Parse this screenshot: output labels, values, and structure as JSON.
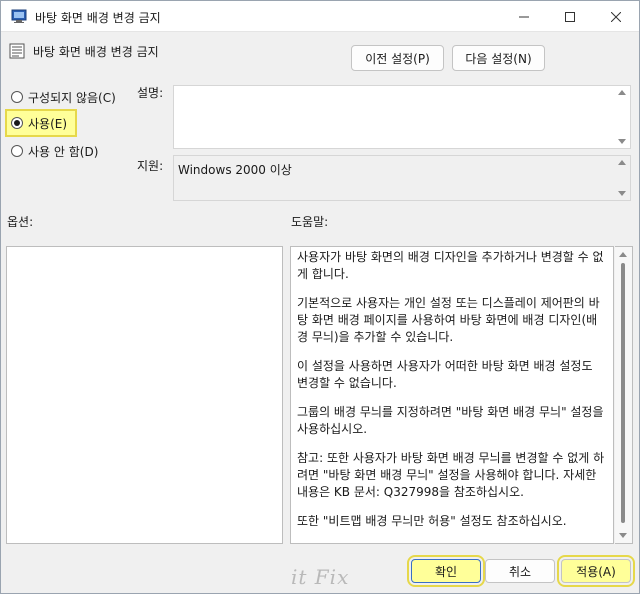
{
  "window": {
    "title": "바탕 화면 배경 변경 금지",
    "controls": {
      "minimize": "minimize-icon",
      "maximize": "maximize-icon",
      "close": "close-icon"
    }
  },
  "header": {
    "policy_title": "바탕 화면 배경 변경 금지",
    "prev_button": "이전 설정(P)",
    "next_button": "다음 설정(N)"
  },
  "radios": [
    {
      "label": "구성되지 않음(C)",
      "checked": false
    },
    {
      "label": "사용(E)",
      "checked": true
    },
    {
      "label": "사용 안 함(D)",
      "checked": false
    }
  ],
  "comment": {
    "label": "설명:",
    "value": ""
  },
  "supported": {
    "label": "지원:",
    "value": "Windows 2000 이상"
  },
  "options": {
    "label": "옵션:"
  },
  "help": {
    "label": "도움말:",
    "paragraphs": [
      "사용자가 바탕 화면의 배경 디자인을 추가하거나 변경할 수 없게 합니다.",
      "기본적으로 사용자는 개인 설정 또는 디스플레이 제어판의 바탕 화면 배경 페이지를 사용하여 바탕 화면에 배경 디자인(배경 무늬)을 추가할 수 있습니다.",
      "이 설정을 사용하면 사용자가 어떠한 바탕 화면 배경 설정도 변경할 수 없습니다.",
      "그룹의 배경 무늬를 지정하려면 \"바탕 화면 배경 무늬\" 설정을 사용하십시오.",
      "참고: 또한 사용자가 바탕 화면 배경 무늬를 변경할 수 없게 하려면 \"바탕 화면 배경 무늬\" 설정을 사용해야 합니다. 자세한 내용은 KB 문서: Q327998을 참조하십시오.",
      "또한 \"비트맵 배경 무늬만 허용\" 설정도 참조하십시오."
    ]
  },
  "footer": {
    "ok": "확인",
    "cancel": "취소",
    "apply": "적용(A)"
  },
  "watermark": "it Fix",
  "colors": {
    "highlight": "#ffff99",
    "highlight_border": "#e6d84a"
  }
}
